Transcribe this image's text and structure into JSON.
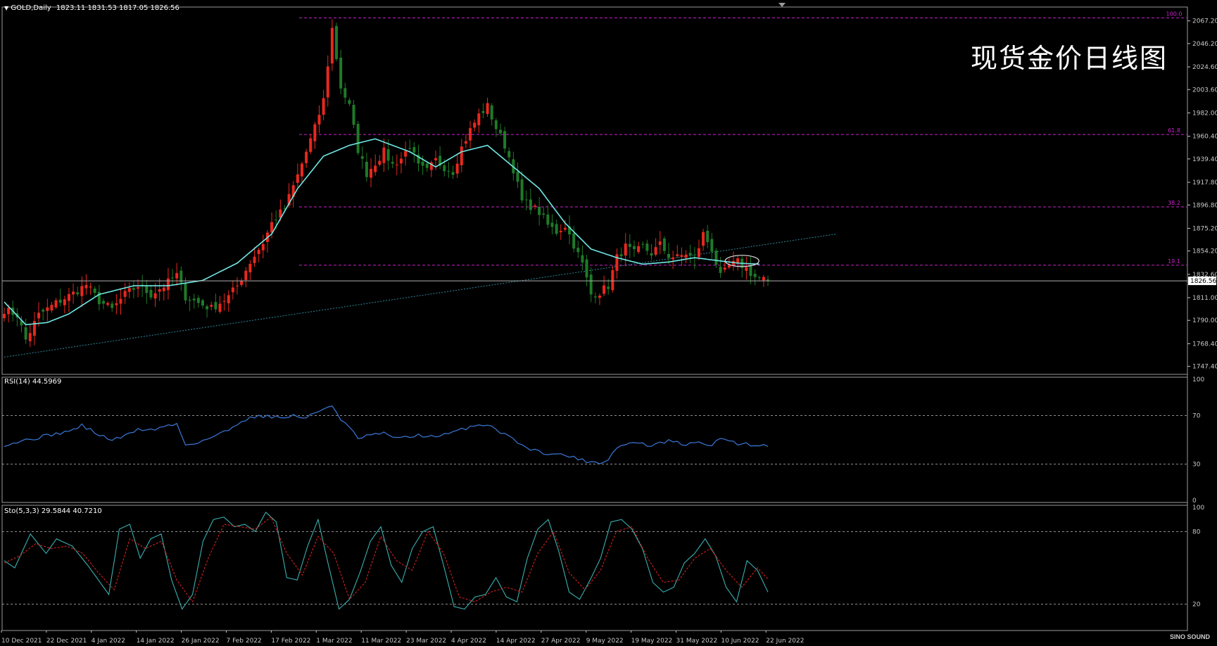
{
  "header": {
    "symbol": "GOLD,Daily",
    "ohlc": "1823.11 1831.53 1817.05 1826.56"
  },
  "overlay_title": "现货金价日线图",
  "watermark": "SINO SOUND",
  "colors": {
    "background": "#000000",
    "bull": "#e8281e",
    "bear": "#1e7a28",
    "ma": "#6fe8e4",
    "fib": "#cc22cc",
    "trend": "#2e8a9a",
    "rsi": "#3a78d8",
    "sto_main": "#3ab0b0",
    "sto_signal": "#d02020",
    "axis": "#c8c8c8"
  },
  "chart_data": [
    {
      "type": "candlestick",
      "title": "GOLD,Daily",
      "ylim": [
        1740,
        2080
      ],
      "yticks": [
        "2067.20",
        "2046.20",
        "2024.60",
        "2003.60",
        "1982.00",
        "1960.40",
        "1939.40",
        "1917.80",
        "1896.80",
        "1875.20",
        "1854.20",
        "1832.60",
        "1811.00",
        "1790.00",
        "1768.40",
        "1747.40"
      ],
      "last_price": "1826.56",
      "x_labels": [
        "10 Dec 2021",
        "22 Dec 2021",
        "4 Jan 2022",
        "14 Jan 2022",
        "26 Jan 2022",
        "7 Feb 2022",
        "17 Feb 2022",
        "1 Mar 2022",
        "11 Mar 2022",
        "23 Mar 2022",
        "4 Apr 2022",
        "14 Apr 2022",
        "27 Apr 2022",
        "9 May 2022",
        "19 May 2022",
        "31 May 2022",
        "10 Jun 2022",
        "22 Jun 2022"
      ],
      "fib_levels": [
        {
          "label": "100.0",
          "value": 2070
        },
        {
          "label": "61.8",
          "value": 1962
        },
        {
          "label": "38.2",
          "value": 1895
        },
        {
          "label": "19.1",
          "value": 1841
        }
      ],
      "trendline": {
        "from": [
          0,
          1756
        ],
        "to": [
          193,
          1870
        ]
      },
      "ma_anchors": [
        [
          0,
          1807
        ],
        [
          5,
          1786
        ],
        [
          10,
          1788
        ],
        [
          15,
          1796
        ],
        [
          22,
          1814
        ],
        [
          30,
          1822
        ],
        [
          38,
          1822
        ],
        [
          46,
          1827
        ],
        [
          54,
          1843
        ],
        [
          62,
          1870
        ],
        [
          68,
          1912
        ],
        [
          74,
          1942
        ],
        [
          80,
          1952
        ],
        [
          86,
          1958
        ],
        [
          94,
          1946
        ],
        [
          100,
          1932
        ],
        [
          106,
          1946
        ],
        [
          112,
          1952
        ],
        [
          118,
          1932
        ],
        [
          124,
          1912
        ],
        [
          130,
          1880
        ],
        [
          136,
          1856
        ],
        [
          142,
          1848
        ],
        [
          148,
          1842
        ],
        [
          154,
          1844
        ],
        [
          160,
          1848
        ],
        [
          166,
          1845
        ],
        [
          170,
          1843
        ],
        [
          175,
          1842
        ]
      ],
      "ohlc_anchors": [
        [
          0,
          1800
        ],
        [
          3,
          1795
        ],
        [
          5,
          1772
        ],
        [
          8,
          1795
        ],
        [
          12,
          1806
        ],
        [
          16,
          1815
        ],
        [
          19,
          1823
        ],
        [
          22,
          1808
        ],
        [
          25,
          1800
        ],
        [
          28,
          1814
        ],
        [
          31,
          1822
        ],
        [
          34,
          1814
        ],
        [
          37,
          1822
        ],
        [
          40,
          1832
        ],
        [
          42,
          1812
        ],
        [
          45,
          1806
        ],
        [
          48,
          1801
        ],
        [
          52,
          1812
        ],
        [
          54,
          1822
        ],
        [
          57,
          1844
        ],
        [
          60,
          1862
        ],
        [
          62,
          1880
        ],
        [
          65,
          1894
        ],
        [
          68,
          1924
        ],
        [
          70,
          1946
        ],
        [
          72,
          1968
        ],
        [
          74,
          1994
        ],
        [
          76,
          2060
        ],
        [
          78,
          2006
        ],
        [
          80,
          1988
        ],
        [
          82,
          1948
        ],
        [
          84,
          1926
        ],
        [
          86,
          1936
        ],
        [
          88,
          1946
        ],
        [
          90,
          1934
        ],
        [
          92,
          1940
        ],
        [
          94,
          1952
        ],
        [
          96,
          1932
        ],
        [
          98,
          1928
        ],
        [
          100,
          1938
        ],
        [
          102,
          1932
        ],
        [
          104,
          1928
        ],
        [
          106,
          1950
        ],
        [
          108,
          1966
        ],
        [
          110,
          1980
        ],
        [
          112,
          1988
        ],
        [
          114,
          1968
        ],
        [
          116,
          1952
        ],
        [
          118,
          1930
        ],
        [
          120,
          1900
        ],
        [
          122,
          1896
        ],
        [
          124,
          1890
        ],
        [
          126,
          1878
        ],
        [
          128,
          1872
        ],
        [
          130,
          1878
        ],
        [
          132,
          1860
        ],
        [
          134,
          1842
        ],
        [
          136,
          1814
        ],
        [
          138,
          1816
        ],
        [
          140,
          1822
        ],
        [
          142,
          1848
        ],
        [
          144,
          1858
        ],
        [
          146,
          1852
        ],
        [
          148,
          1858
        ],
        [
          150,
          1852
        ],
        [
          152,
          1860
        ],
        [
          154,
          1850
        ],
        [
          156,
          1848
        ],
        [
          158,
          1852
        ],
        [
          160,
          1846
        ],
        [
          162,
          1870
        ],
        [
          164,
          1856
        ],
        [
          166,
          1830
        ],
        [
          168,
          1840
        ],
        [
          170,
          1844
        ],
        [
          172,
          1838
        ],
        [
          174,
          1830
        ],
        [
          176,
          1828
        ],
        [
          177,
          1826.56
        ]
      ],
      "n_bars": 178
    },
    {
      "type": "line",
      "title": "RSI(14) 44.5969",
      "ylim": [
        0,
        100
      ],
      "yticks": [
        "100",
        "70",
        "30",
        "0"
      ],
      "levels": [
        70,
        30
      ],
      "anchors": [
        [
          0,
          46
        ],
        [
          4,
          49
        ],
        [
          8,
          52
        ],
        [
          12,
          55
        ],
        [
          16,
          58
        ],
        [
          18,
          62
        ],
        [
          22,
          54
        ],
        [
          25,
          50
        ],
        [
          28,
          53
        ],
        [
          31,
          59
        ],
        [
          34,
          58
        ],
        [
          37,
          61
        ],
        [
          40,
          63
        ],
        [
          42,
          46
        ],
        [
          45,
          48
        ],
        [
          48,
          52
        ],
        [
          52,
          58
        ],
        [
          55,
          66
        ],
        [
          58,
          69
        ],
        [
          61,
          70
        ],
        [
          64,
          68
        ],
        [
          67,
          70
        ],
        [
          70,
          68
        ],
        [
          73,
          74
        ],
        [
          76,
          79
        ],
        [
          78,
          66
        ],
        [
          80,
          60
        ],
        [
          82,
          51
        ],
        [
          85,
          54
        ],
        [
          88,
          55
        ],
        [
          92,
          51
        ],
        [
          96,
          54
        ],
        [
          100,
          52
        ],
        [
          104,
          56
        ],
        [
          108,
          61
        ],
        [
          112,
          63
        ],
        [
          114,
          59
        ],
        [
          116,
          54
        ],
        [
          118,
          52
        ],
        [
          120,
          45
        ],
        [
          124,
          40
        ],
        [
          128,
          38
        ],
        [
          132,
          36
        ],
        [
          134,
          33
        ],
        [
          138,
          31
        ],
        [
          140,
          34
        ],
        [
          142,
          44
        ],
        [
          146,
          48
        ],
        [
          150,
          45
        ],
        [
          154,
          49
        ],
        [
          158,
          46
        ],
        [
          162,
          48
        ],
        [
          164,
          44
        ],
        [
          166,
          52
        ],
        [
          170,
          47
        ],
        [
          174,
          46
        ],
        [
          177,
          44.6
        ]
      ]
    },
    {
      "type": "line",
      "title": "Sto(5,3,3) 29.5844 40.7210",
      "ylim": [
        0,
        100
      ],
      "yticks": [
        "100",
        "80",
        "20"
      ],
      "levels": [
        80,
        20
      ],
      "series": [
        {
          "name": "main",
          "anchors": [
            [
              0,
              56
            ],
            [
              2,
              50
            ],
            [
              5,
              78
            ],
            [
              8,
              62
            ],
            [
              10,
              74
            ],
            [
              13,
              68
            ],
            [
              16,
              52
            ],
            [
              18,
              40
            ],
            [
              20,
              28
            ],
            [
              22,
              82
            ],
            [
              24,
              86
            ],
            [
              26,
              58
            ],
            [
              28,
              74
            ],
            [
              30,
              78
            ],
            [
              32,
              40
            ],
            [
              34,
              16
            ],
            [
              36,
              28
            ],
            [
              38,
              72
            ],
            [
              40,
              90
            ],
            [
              42,
              92
            ],
            [
              44,
              84
            ],
            [
              46,
              86
            ],
            [
              48,
              80
            ],
            [
              50,
              96
            ],
            [
              52,
              88
            ],
            [
              54,
              42
            ],
            [
              56,
              40
            ],
            [
              58,
              68
            ],
            [
              60,
              90
            ],
            [
              62,
              52
            ],
            [
              64,
              16
            ],
            [
              66,
              24
            ],
            [
              68,
              46
            ],
            [
              70,
              72
            ],
            [
              72,
              84
            ],
            [
              74,
              52
            ],
            [
              76,
              38
            ],
            [
              78,
              66
            ],
            [
              80,
              80
            ],
            [
              82,
              84
            ],
            [
              84,
              52
            ],
            [
              86,
              18
            ],
            [
              88,
              16
            ],
            [
              90,
              26
            ],
            [
              92,
              28
            ],
            [
              94,
              42
            ],
            [
              96,
              26
            ],
            [
              98,
              22
            ],
            [
              100,
              58
            ],
            [
              102,
              82
            ],
            [
              104,
              90
            ],
            [
              106,
              64
            ],
            [
              108,
              30
            ],
            [
              110,
              24
            ],
            [
              112,
              40
            ],
            [
              114,
              58
            ],
            [
              116,
              88
            ],
            [
              118,
              90
            ],
            [
              120,
              82
            ],
            [
              122,
              66
            ],
            [
              124,
              38
            ],
            [
              126,
              30
            ],
            [
              128,
              34
            ],
            [
              130,
              54
            ],
            [
              132,
              62
            ],
            [
              134,
              74
            ],
            [
              136,
              60
            ],
            [
              138,
              34
            ],
            [
              140,
              22
            ],
            [
              142,
              56
            ],
            [
              144,
              48
            ],
            [
              146,
              30
            ]
          ]
        },
        {
          "name": "signal",
          "anchors": [
            [
              0,
              54
            ],
            [
              3,
              60
            ],
            [
              6,
              70
            ],
            [
              9,
              66
            ],
            [
              12,
              68
            ],
            [
              15,
              62
            ],
            [
              18,
              46
            ],
            [
              21,
              32
            ],
            [
              24,
              74
            ],
            [
              27,
              66
            ],
            [
              30,
              72
            ],
            [
              33,
              40
            ],
            [
              36,
              22
            ],
            [
              39,
              58
            ],
            [
              42,
              86
            ],
            [
              45,
              84
            ],
            [
              48,
              82
            ],
            [
              51,
              92
            ],
            [
              54,
              62
            ],
            [
              57,
              44
            ],
            [
              60,
              76
            ],
            [
              63,
              62
            ],
            [
              66,
              24
            ],
            [
              69,
              38
            ],
            [
              72,
              76
            ],
            [
              75,
              56
            ],
            [
              78,
              48
            ],
            [
              81,
              80
            ],
            [
              84,
              62
            ],
            [
              87,
              26
            ],
            [
              90,
              22
            ],
            [
              93,
              30
            ],
            [
              96,
              34
            ],
            [
              99,
              30
            ],
            [
              102,
              62
            ],
            [
              105,
              80
            ],
            [
              108,
              46
            ],
            [
              111,
              32
            ],
            [
              114,
              48
            ],
            [
              117,
              80
            ],
            [
              120,
              84
            ],
            [
              123,
              58
            ],
            [
              126,
              38
            ],
            [
              129,
              40
            ],
            [
              132,
              58
            ],
            [
              135,
              66
            ],
            [
              138,
              48
            ],
            [
              141,
              34
            ],
            [
              144,
              50
            ],
            [
              146,
              40.7
            ]
          ]
        }
      ]
    }
  ]
}
